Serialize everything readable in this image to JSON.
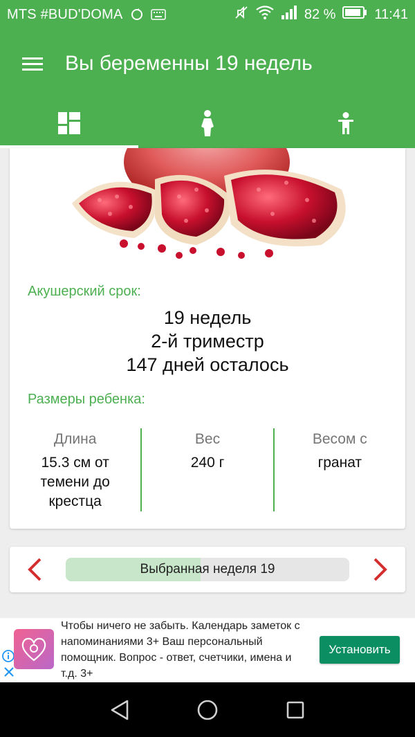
{
  "status_bar": {
    "carrier": "MTS #BUD'DOMA",
    "battery": "82 %",
    "time": "11:41"
  },
  "app_bar": {
    "title": "Вы беременны 19 недель",
    "menu_icon": "hamburger-icon"
  },
  "tabs": [
    {
      "icon": "dashboard-icon",
      "active": true
    },
    {
      "icon": "woman-icon",
      "active": false
    },
    {
      "icon": "child-icon",
      "active": false
    }
  ],
  "card": {
    "image": "pomegranate",
    "term_label": "Акушерский срок:",
    "term_lines": [
      "19 недель",
      "2-й триместр",
      "147 дней осталось"
    ],
    "sizes_label": "Размеры ребенка:",
    "sizes": [
      {
        "head": "Длина",
        "value": "15.3 см от темени до крестца"
      },
      {
        "head": "Вес",
        "value": "240 г"
      },
      {
        "head": "Весом с",
        "value": "гранат"
      }
    ]
  },
  "week_selector": {
    "label": "Выбранная неделя 19",
    "progress": 0.475,
    "prev_icon": "chevron-left-icon",
    "next_icon": "chevron-right-icon"
  },
  "ad": {
    "text": "Чтобы ничего не забыть. Календарь заметок с напоминаниями 3+ Ваш персональный помощник. Вопрос - ответ, счетчики, имена и т.д. 3+",
    "install_label": "Установить"
  },
  "colors": {
    "primary": "#4caf50",
    "arrow": "#d32f2f",
    "install": "#0b8f62",
    "progress_fill": "#c8e6c9"
  }
}
